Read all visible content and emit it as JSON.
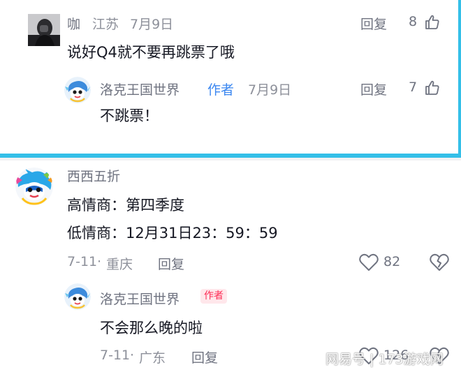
{
  "colors": {
    "accent_blue": "#34bfe8",
    "author_blue": "#3b87f0",
    "author_red": "#fe2c55",
    "text_primary": "#161823",
    "text_secondary": "#8d909a"
  },
  "top_panel": {
    "comment": {
      "username": "咖",
      "location": "江苏",
      "date": "7月9日",
      "text": "说好Q4就不要再跳票了哦",
      "reply_label": "回复",
      "likes": "8",
      "avatar_icon": "person-photo-avatar",
      "like_icon": "thumbs-up-icon"
    },
    "reply": {
      "username": "洛克王国世界",
      "author_tag": "作者",
      "date": "7月9日",
      "text": "不跳票！",
      "reply_label": "回复",
      "likes": "7",
      "avatar_icon": "mascot-avatar",
      "like_icon": "thumbs-up-icon"
    }
  },
  "bottom_panel": {
    "comment": {
      "username": "西西五折",
      "line1": "高情商：第四季度",
      "line2": "低情商：12月31日23：59：59",
      "date": "7-11",
      "location": "重庆",
      "separator": "·",
      "reply_label": "回复",
      "likes": "82",
      "avatar_icon": "mascot-avatar-colorful",
      "like_icon": "heart-icon",
      "dislike_icon": "broken-heart-icon"
    },
    "reply": {
      "username": "洛克王国世界",
      "author_tag": "作者",
      "text": "不会那么晚的啦",
      "date": "7-11",
      "location": "广东",
      "separator": "·",
      "reply_label": "回复",
      "likes": "126",
      "avatar_icon": "mascot-avatar",
      "like_icon": "heart-icon",
      "dislike_icon": "broken-heart-icon"
    }
  },
  "watermark": "网易号 | 173游戏网"
}
